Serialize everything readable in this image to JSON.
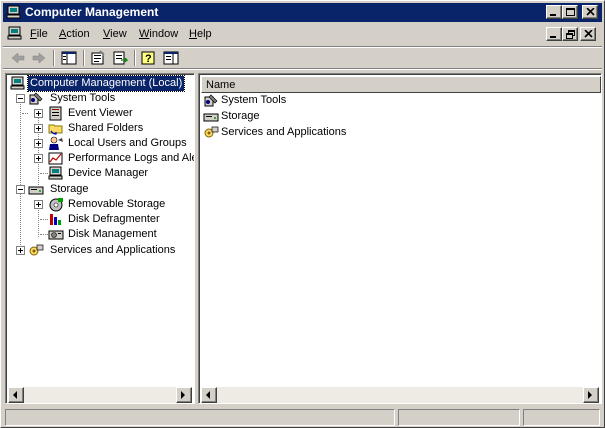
{
  "window": {
    "title": "Computer Management",
    "colors": {
      "titlebar": "#0a246a",
      "face": "#d4d0c8",
      "selection": "#0a246a"
    }
  },
  "menu": {
    "items": [
      {
        "label": "File",
        "accel": "F",
        "rest": "ile"
      },
      {
        "label": "Action",
        "accel": "A",
        "rest": "ction"
      },
      {
        "label": "View",
        "accel": "V",
        "rest": "iew"
      },
      {
        "label": "Window",
        "accel": "W",
        "rest": "indow"
      },
      {
        "label": "Help",
        "accel": "H",
        "rest": "elp"
      }
    ]
  },
  "toolbar": {
    "icons": [
      "back-arrow-icon",
      "forward-arrow-icon",
      "show-hide-tree-icon",
      "properties-icon",
      "export-list-icon",
      "help-icon",
      "show-hide-action-pane-icon"
    ]
  },
  "tree": {
    "root": "Computer Management (Local)",
    "system_tools": "System Tools",
    "event_viewer": "Event Viewer",
    "shared_folders": "Shared Folders",
    "local_users": "Local Users and Groups",
    "perf_logs": "Performance Logs and Alerts",
    "device_manager": "Device Manager",
    "storage": "Storage",
    "removable_storage": "Removable Storage",
    "disk_defrag": "Disk Defragmenter",
    "disk_management": "Disk Management",
    "services_apps": "Services and Applications"
  },
  "list": {
    "column_name": "Name",
    "items": [
      "System Tools",
      "Storage",
      "Services and Applications"
    ]
  }
}
